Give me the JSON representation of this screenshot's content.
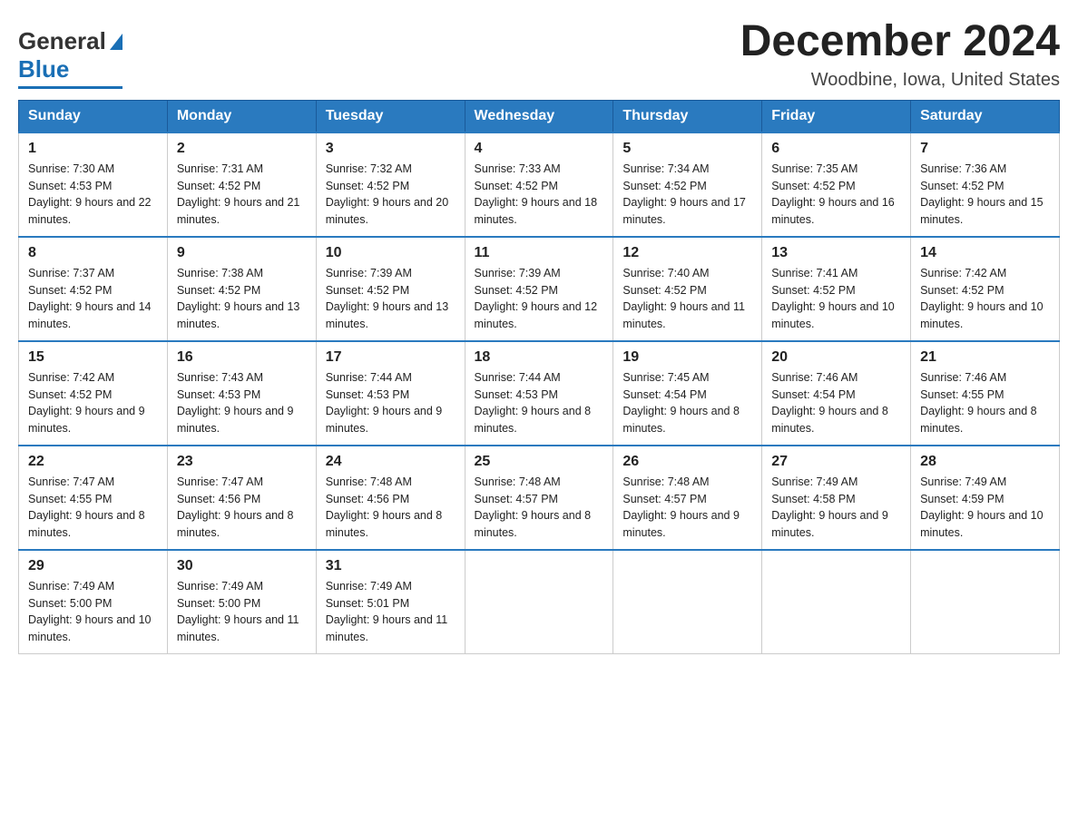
{
  "header": {
    "month_title": "December 2024",
    "location": "Woodbine, Iowa, United States",
    "logo_general": "General",
    "logo_blue": "Blue"
  },
  "days_of_week": [
    "Sunday",
    "Monday",
    "Tuesday",
    "Wednesday",
    "Thursday",
    "Friday",
    "Saturday"
  ],
  "weeks": [
    [
      {
        "day": "1",
        "sunrise": "Sunrise: 7:30 AM",
        "sunset": "Sunset: 4:53 PM",
        "daylight": "Daylight: 9 hours and 22 minutes."
      },
      {
        "day": "2",
        "sunrise": "Sunrise: 7:31 AM",
        "sunset": "Sunset: 4:52 PM",
        "daylight": "Daylight: 9 hours and 21 minutes."
      },
      {
        "day": "3",
        "sunrise": "Sunrise: 7:32 AM",
        "sunset": "Sunset: 4:52 PM",
        "daylight": "Daylight: 9 hours and 20 minutes."
      },
      {
        "day": "4",
        "sunrise": "Sunrise: 7:33 AM",
        "sunset": "Sunset: 4:52 PM",
        "daylight": "Daylight: 9 hours and 18 minutes."
      },
      {
        "day": "5",
        "sunrise": "Sunrise: 7:34 AM",
        "sunset": "Sunset: 4:52 PM",
        "daylight": "Daylight: 9 hours and 17 minutes."
      },
      {
        "day": "6",
        "sunrise": "Sunrise: 7:35 AM",
        "sunset": "Sunset: 4:52 PM",
        "daylight": "Daylight: 9 hours and 16 minutes."
      },
      {
        "day": "7",
        "sunrise": "Sunrise: 7:36 AM",
        "sunset": "Sunset: 4:52 PM",
        "daylight": "Daylight: 9 hours and 15 minutes."
      }
    ],
    [
      {
        "day": "8",
        "sunrise": "Sunrise: 7:37 AM",
        "sunset": "Sunset: 4:52 PM",
        "daylight": "Daylight: 9 hours and 14 minutes."
      },
      {
        "day": "9",
        "sunrise": "Sunrise: 7:38 AM",
        "sunset": "Sunset: 4:52 PM",
        "daylight": "Daylight: 9 hours and 13 minutes."
      },
      {
        "day": "10",
        "sunrise": "Sunrise: 7:39 AM",
        "sunset": "Sunset: 4:52 PM",
        "daylight": "Daylight: 9 hours and 13 minutes."
      },
      {
        "day": "11",
        "sunrise": "Sunrise: 7:39 AM",
        "sunset": "Sunset: 4:52 PM",
        "daylight": "Daylight: 9 hours and 12 minutes."
      },
      {
        "day": "12",
        "sunrise": "Sunrise: 7:40 AM",
        "sunset": "Sunset: 4:52 PM",
        "daylight": "Daylight: 9 hours and 11 minutes."
      },
      {
        "day": "13",
        "sunrise": "Sunrise: 7:41 AM",
        "sunset": "Sunset: 4:52 PM",
        "daylight": "Daylight: 9 hours and 10 minutes."
      },
      {
        "day": "14",
        "sunrise": "Sunrise: 7:42 AM",
        "sunset": "Sunset: 4:52 PM",
        "daylight": "Daylight: 9 hours and 10 minutes."
      }
    ],
    [
      {
        "day": "15",
        "sunrise": "Sunrise: 7:42 AM",
        "sunset": "Sunset: 4:52 PM",
        "daylight": "Daylight: 9 hours and 9 minutes."
      },
      {
        "day": "16",
        "sunrise": "Sunrise: 7:43 AM",
        "sunset": "Sunset: 4:53 PM",
        "daylight": "Daylight: 9 hours and 9 minutes."
      },
      {
        "day": "17",
        "sunrise": "Sunrise: 7:44 AM",
        "sunset": "Sunset: 4:53 PM",
        "daylight": "Daylight: 9 hours and 9 minutes."
      },
      {
        "day": "18",
        "sunrise": "Sunrise: 7:44 AM",
        "sunset": "Sunset: 4:53 PM",
        "daylight": "Daylight: 9 hours and 8 minutes."
      },
      {
        "day": "19",
        "sunrise": "Sunrise: 7:45 AM",
        "sunset": "Sunset: 4:54 PM",
        "daylight": "Daylight: 9 hours and 8 minutes."
      },
      {
        "day": "20",
        "sunrise": "Sunrise: 7:46 AM",
        "sunset": "Sunset: 4:54 PM",
        "daylight": "Daylight: 9 hours and 8 minutes."
      },
      {
        "day": "21",
        "sunrise": "Sunrise: 7:46 AM",
        "sunset": "Sunset: 4:55 PM",
        "daylight": "Daylight: 9 hours and 8 minutes."
      }
    ],
    [
      {
        "day": "22",
        "sunrise": "Sunrise: 7:47 AM",
        "sunset": "Sunset: 4:55 PM",
        "daylight": "Daylight: 9 hours and 8 minutes."
      },
      {
        "day": "23",
        "sunrise": "Sunrise: 7:47 AM",
        "sunset": "Sunset: 4:56 PM",
        "daylight": "Daylight: 9 hours and 8 minutes."
      },
      {
        "day": "24",
        "sunrise": "Sunrise: 7:48 AM",
        "sunset": "Sunset: 4:56 PM",
        "daylight": "Daylight: 9 hours and 8 minutes."
      },
      {
        "day": "25",
        "sunrise": "Sunrise: 7:48 AM",
        "sunset": "Sunset: 4:57 PM",
        "daylight": "Daylight: 9 hours and 8 minutes."
      },
      {
        "day": "26",
        "sunrise": "Sunrise: 7:48 AM",
        "sunset": "Sunset: 4:57 PM",
        "daylight": "Daylight: 9 hours and 9 minutes."
      },
      {
        "day": "27",
        "sunrise": "Sunrise: 7:49 AM",
        "sunset": "Sunset: 4:58 PM",
        "daylight": "Daylight: 9 hours and 9 minutes."
      },
      {
        "day": "28",
        "sunrise": "Sunrise: 7:49 AM",
        "sunset": "Sunset: 4:59 PM",
        "daylight": "Daylight: 9 hours and 10 minutes."
      }
    ],
    [
      {
        "day": "29",
        "sunrise": "Sunrise: 7:49 AM",
        "sunset": "Sunset: 5:00 PM",
        "daylight": "Daylight: 9 hours and 10 minutes."
      },
      {
        "day": "30",
        "sunrise": "Sunrise: 7:49 AM",
        "sunset": "Sunset: 5:00 PM",
        "daylight": "Daylight: 9 hours and 11 minutes."
      },
      {
        "day": "31",
        "sunrise": "Sunrise: 7:49 AM",
        "sunset": "Sunset: 5:01 PM",
        "daylight": "Daylight: 9 hours and 11 minutes."
      },
      null,
      null,
      null,
      null
    ]
  ]
}
